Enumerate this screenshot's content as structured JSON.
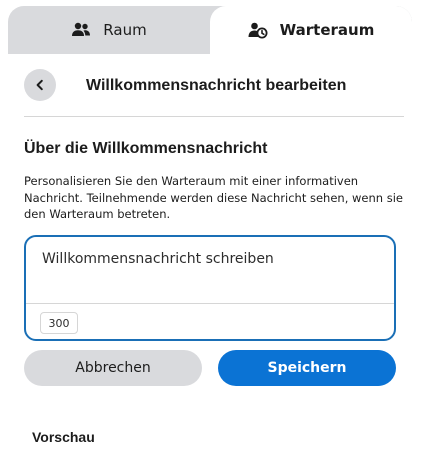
{
  "tabs": [
    {
      "label": "Raum",
      "icon": "people-icon",
      "active": false
    },
    {
      "label": "Warteraum",
      "icon": "waiting-room-icon",
      "active": true
    }
  ],
  "header": {
    "back_icon": "chevron-left-icon",
    "title": "Willkommensnachricht bearbeiten"
  },
  "section": {
    "title": "Über die Willkommensnachricht",
    "description": "Personalisieren Sie den Warteraum mit einer informativen Nachricht. Teilnehmende werden diese Nachricht sehen, wenn sie den Warteraum betreten."
  },
  "message_input": {
    "placeholder": "Willkommensnachricht schreiben",
    "value": "",
    "char_limit": "300"
  },
  "buttons": {
    "cancel_label": "Abbrechen",
    "save_label": "Speichern"
  },
  "preview": {
    "title": "Vorschau"
  },
  "colors": {
    "accent": "#0b73d4",
    "focus_border": "#1a6fb6",
    "tab_inactive_bg": "#d9dadd",
    "button_secondary_bg": "#d9dadd"
  }
}
